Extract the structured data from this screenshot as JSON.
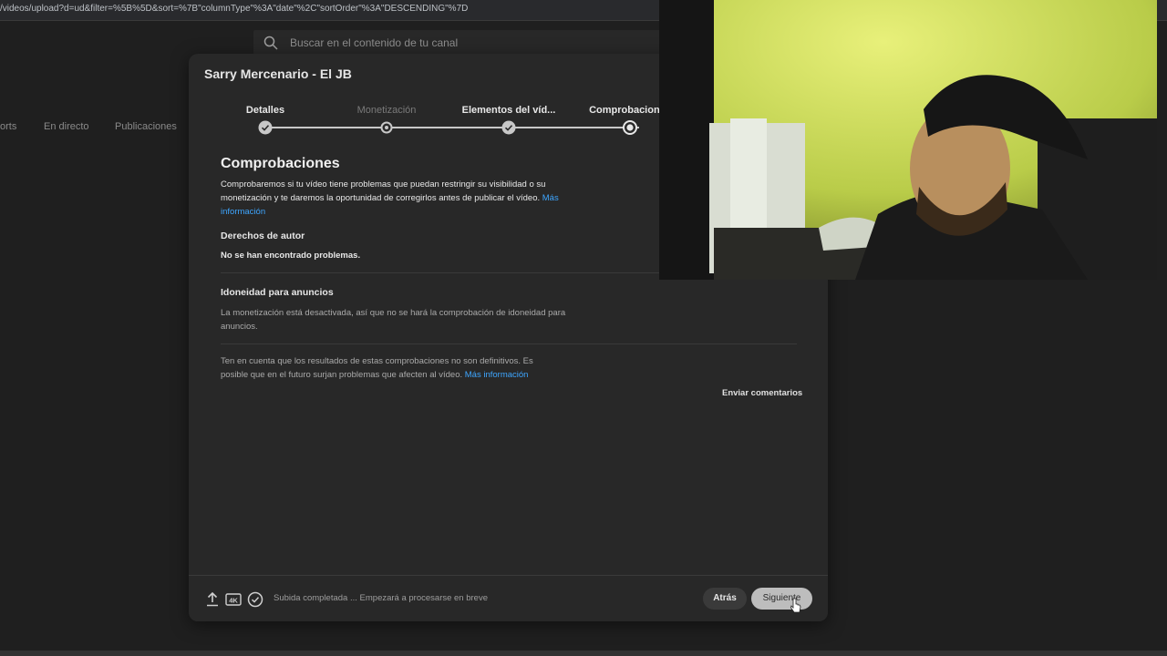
{
  "browser": {
    "url": "/videos/upload?d=ud&filter=%5B%5D&sort=%7B\"columnType\"%3A\"date\"%2C\"sortOrder\"%3A\"DESCENDING\"%7D"
  },
  "header": {
    "search_placeholder": "Buscar en el contenido de tu canal"
  },
  "background_tabs": [
    "orts",
    "En directo",
    "Publicaciones"
  ],
  "dialog": {
    "title": "Sarry Mercenario - El JB",
    "steps": [
      {
        "label": "Detalles",
        "state": "done"
      },
      {
        "label": "Monetización",
        "state": "disabled"
      },
      {
        "label": "Elementos del víd...",
        "state": "done"
      },
      {
        "label": "Comprobaciones",
        "state": "current"
      }
    ],
    "checks": {
      "heading": "Comprobaciones",
      "intro": "Comprobaremos si tu vídeo tiene problemas que puedan restringir su visibilidad o su monetización y te daremos la oportunidad de corregirlos antes de publicar el vídeo.",
      "intro_link": "Más información",
      "copyright_title": "Derechos de autor",
      "copyright_status": "No se han encontrado problemas.",
      "ads_title": "Idoneidad para anuncios",
      "ads_text": "La monetización está desactivada, así que no se hará la comprobación de idoneidad para anuncios.",
      "note": "Ten en cuenta que los resultados de estas comprobaciones no son definitivos. Es posible que en el futuro surjan problemas que afecten al vídeo.",
      "note_link": "Más información",
      "feedback": "Enviar comentarios"
    },
    "footer": {
      "badge_4k": "4K",
      "status": "Subida completada ... Empezará a procesarse en breve",
      "back_label": "Atrás",
      "next_label": "Siguiente"
    }
  },
  "colors": {
    "link": "#3ea6ff",
    "dialog_bg": "#282828",
    "page_bg": "#1f1f1f"
  }
}
